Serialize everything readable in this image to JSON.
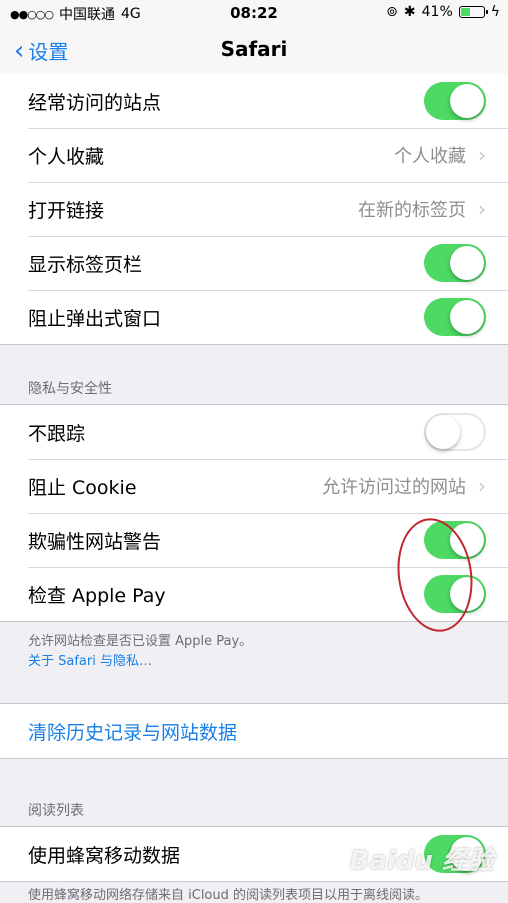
{
  "status_bar": {
    "carrier": "中国联通",
    "network": "4G",
    "time": "08:22",
    "battery": "41%",
    "battery_level": 0.41
  },
  "nav": {
    "back_label": "设置",
    "title": "Safari"
  },
  "general": {
    "frequently_visited": "经常访问的站点",
    "favorites_label": "个人收藏",
    "favorites_value": "个人收藏",
    "open_links_label": "打开链接",
    "open_links_value": "在新的标签页",
    "show_tab_bar": "显示标签页栏",
    "block_popups": "阻止弹出式窗口"
  },
  "privacy": {
    "header": "隐私与安全性",
    "do_not_track": "不跟踪",
    "block_cookies_label": "阻止 Cookie",
    "block_cookies_value": "允许访问过的网站",
    "fraud_warning": "欺骗性网站警告",
    "check_apple_pay": "检查 Apple Pay",
    "footer": "允许网站检查是否已设置 Apple Pay。",
    "footer_link": "关于 Safari 与隐私…"
  },
  "clear_history": "清除历史记录与网站数据",
  "reading_list": {
    "header": "阅读列表",
    "use_cellular": "使用蜂窝移动数据",
    "footer": "使用蜂窝移动网络存储来自 iCloud 的阅读列表项目以用于离线阅读。"
  },
  "watermark": "Baidu 经验",
  "colors": {
    "accent": "#1a7fe6",
    "toggle_on": "#4cd964",
    "annotation": "#c0262d"
  }
}
